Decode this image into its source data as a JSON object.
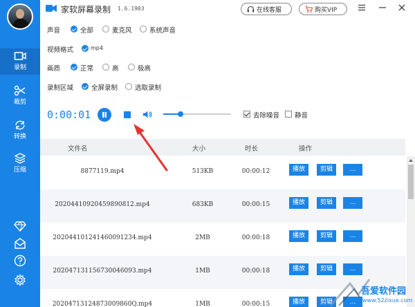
{
  "app": {
    "title": "家软屏幕录制",
    "version": "1.6.1903"
  },
  "header": {
    "service_label": "在线客服",
    "vip_label": "购买VIP"
  },
  "sidebar": {
    "items": [
      {
        "label": "录制",
        "icon": "record-icon"
      },
      {
        "label": "裁剪",
        "icon": "scissors-icon"
      },
      {
        "label": "转换",
        "icon": "convert-icon"
      },
      {
        "label": "压缩",
        "icon": "compress-icon"
      }
    ],
    "bottom_icons": [
      "diamond-icon",
      "mail-icon",
      "help-icon",
      "settings-icon"
    ]
  },
  "settings": {
    "audio": {
      "label": "声音",
      "options": [
        "全部",
        "麦克风",
        "系统声音"
      ],
      "selected": "全部"
    },
    "format": {
      "label": "视频格式",
      "options": [
        "mp4"
      ],
      "selected": "mp4"
    },
    "quality": {
      "label": "画质",
      "options": [
        "正常",
        "高",
        "极高"
      ],
      "selected": "正常"
    },
    "area": {
      "label": "录制区域",
      "options": [
        "全屏录制",
        "选取录制"
      ],
      "selected": "全屏录制"
    }
  },
  "recorder": {
    "timer": "0:00:01",
    "volume_level": 0.25,
    "denoise_label": "去除噪音",
    "denoise_checked": true,
    "mute_label": "静音",
    "mute_checked": false
  },
  "table": {
    "headers": [
      "文件名",
      "大小",
      "时长",
      "操作"
    ],
    "actions": [
      "播放",
      "剪辑",
      "..."
    ],
    "rows": [
      {
        "name": "8877119.mp4",
        "size": "513KB",
        "duration": "00:00:12"
      },
      {
        "name": "20204410920459890812.mp4",
        "size": "683KB",
        "duration": "00:00:15"
      },
      {
        "name": "202044101241460091234.mp4",
        "size": "2MB",
        "duration": "00:00:18"
      },
      {
        "name": "20204713115673004609З.mp4",
        "size": "1MB",
        "duration": "00:00:18"
      },
      {
        "name": "20204713124873009860Q.mp4",
        "size": "1MB",
        "duration": "00:00:15"
      }
    ]
  },
  "watermark": {
    "name": "吾爱软件园",
    "url": "www.52zixue.com"
  },
  "colors": {
    "accent": "#1a84e6",
    "arrow": "#e63232"
  }
}
